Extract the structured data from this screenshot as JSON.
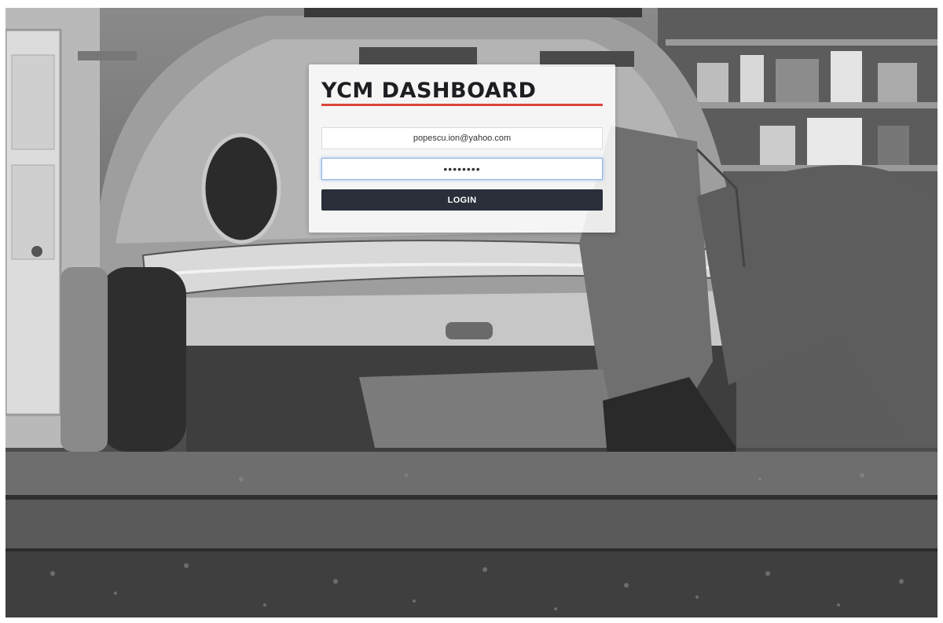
{
  "app": {
    "title": "YCM DASHBOARD",
    "accent_color": "#d9473b"
  },
  "login": {
    "email_value": "popescu.ion@yahoo.com",
    "password_value": "••••••••",
    "button_label": "LOGIN"
  },
  "background": {
    "scene": "grayscale photo: mechanic lying under a classic car in a garage"
  },
  "colors": {
    "button_bg": "#2a2f3a",
    "button_text": "#ffffff",
    "focus_border": "#8fb4e6"
  }
}
